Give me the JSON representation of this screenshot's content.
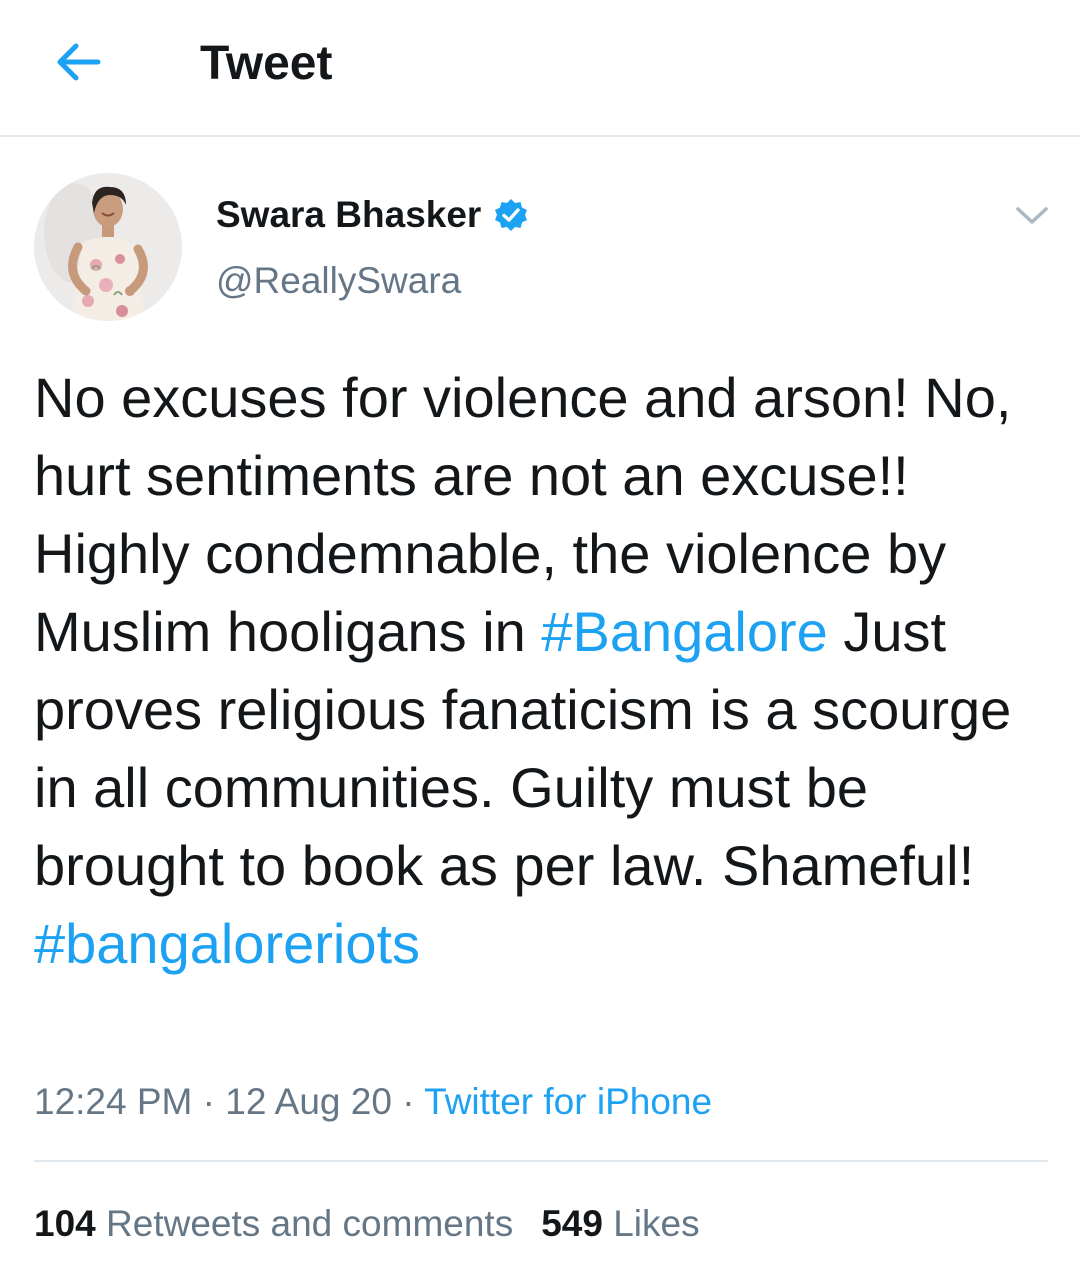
{
  "header": {
    "title": "Tweet",
    "back_icon": "arrow-left-icon",
    "accent_color": "#1da1f2"
  },
  "author": {
    "name": "Swara Bhasker",
    "handle": "@ReallySwara",
    "verified_icon": "verified-badge-icon",
    "more_icon": "chevron-down-icon"
  },
  "tweet": {
    "text_1": "No excuses for violence and arson! No, hurt sentiments are not an excuse!! Highly condemnable, the violence by Muslim hooligans in ",
    "hashtag_1": "#Bangalore",
    "text_2": " Just proves religious fanaticism is a scourge in all communities. Guilty must be brought to book as per law. Shameful! ",
    "hashtag_2": "#bangaloreriots"
  },
  "meta": {
    "time": "12:24 PM",
    "separator_1": " · ",
    "date": "12 Aug 20",
    "separator_2": " · ",
    "source": "Twitter for iPhone"
  },
  "stats": {
    "retweets_count": "104",
    "retweets_label": "Retweets and comments",
    "likes_count": "549",
    "likes_label": "Likes"
  },
  "colors": {
    "text": "#14171a",
    "secondary": "#657786",
    "link": "#1da1f2",
    "divider": "#e1e8ed"
  }
}
